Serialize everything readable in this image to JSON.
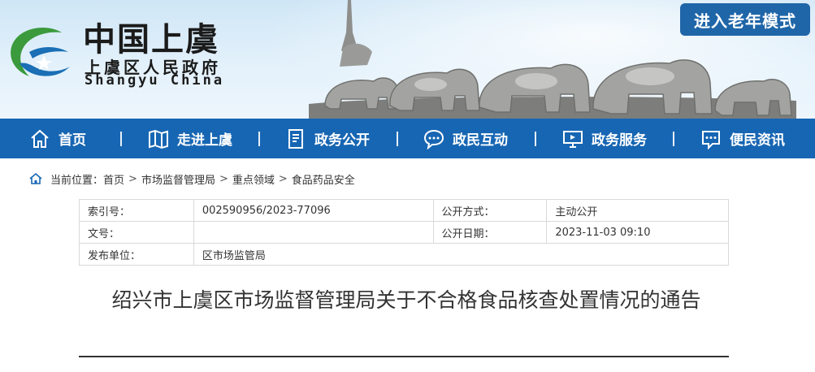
{
  "header": {
    "site_name": "中国上虞",
    "district": "上虞区人民政府",
    "english": "Shangyu China",
    "elder_mode_label": "进入老年模式"
  },
  "nav": {
    "items": [
      {
        "label": "首页",
        "icon": "home-icon"
      },
      {
        "label": "走进上虞",
        "icon": "map-icon"
      },
      {
        "label": "政务公开",
        "icon": "document-icon"
      },
      {
        "label": "政民互动",
        "icon": "chat-icon"
      },
      {
        "label": "政务服务",
        "icon": "monitor-icon"
      },
      {
        "label": "便民资讯",
        "icon": "info-icon"
      }
    ]
  },
  "breadcrumb": {
    "prefix": "当前位置：",
    "items": [
      "首页",
      "市场监督管理局",
      "重点领域",
      "食品药品安全"
    ],
    "separator": ">"
  },
  "meta": {
    "index_label": "索引号：",
    "index_value": "002590956/2023-77096",
    "publish_method_label": "公开方式：",
    "publish_method_value": "主动公开",
    "doc_no_label": "文号：",
    "doc_no_value": "",
    "publish_date_label": "公开日期：",
    "publish_date_value": "2023-11-03 09:10",
    "issuer_label": "发布单位：",
    "issuer_value": "区市场监管局"
  },
  "article": {
    "title": "绍兴市上虞区市场监督管理局关于不合格食品核查处置情况的通告"
  },
  "colors": {
    "nav_bg": "#1766b3",
    "elder_btn_bg": "#1f66a8",
    "logo_green": "#3a9a3c",
    "logo_blue": "#1a6fb5"
  }
}
